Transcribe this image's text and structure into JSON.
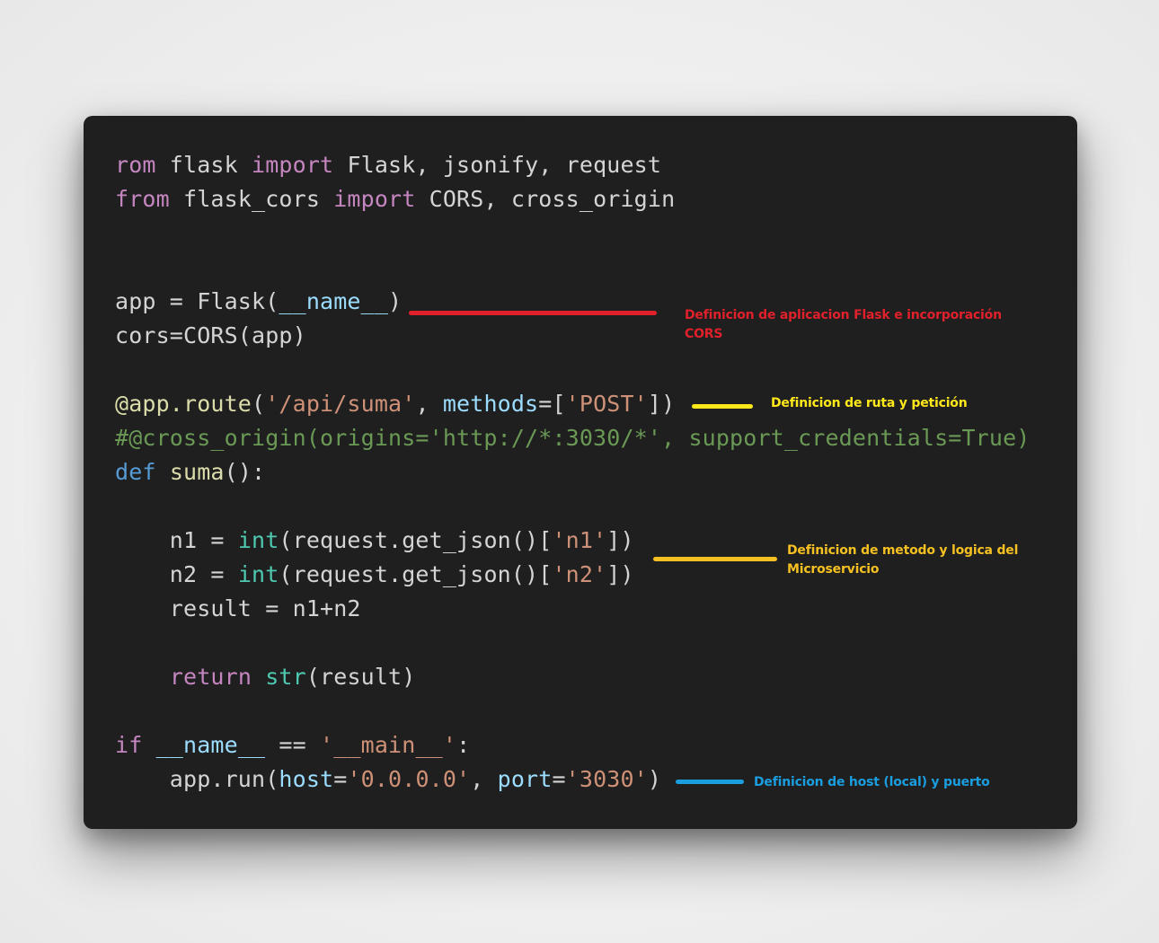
{
  "code": {
    "line1": {
      "t1": "rom",
      "t2": " flask ",
      "t3": "import",
      "t4": " Flask, jsonify, request"
    },
    "line2": {
      "t1": "from",
      "t2": " flask_cors ",
      "t3": "import",
      "t4": " CORS, cross_origin"
    },
    "line3": {
      "t1": "app = Flask(",
      "t2": "__name__",
      "t3": ")"
    },
    "line4": {
      "t1": "cors=CORS(app)"
    },
    "line5": {
      "t1": "@app.route",
      "t2": "(",
      "t3": "'/api/suma'",
      "t4": ", ",
      "t5": "methods",
      "t6": "=[",
      "t7": "'POST'",
      "t8": "])"
    },
    "line6": {
      "t1": "#@cross_origin(origins='http://*:3030/*', support_credentials=True)"
    },
    "line7": {
      "t1": "def",
      "t2": " ",
      "t3": "suma",
      "t4": "():"
    },
    "line8": {
      "t1": "    n1 = ",
      "t2": "int",
      "t3": "(request.get_json()[",
      "t4": "'n1'",
      "t5": "])"
    },
    "line9": {
      "t1": "    n2 = ",
      "t2": "int",
      "t3": "(request.get_json()[",
      "t4": "'n2'",
      "t5": "])"
    },
    "line10": {
      "t1": "    result = n1+n2"
    },
    "line11": {
      "t1": "    ",
      "t2": "return",
      "t3": " ",
      "t4": "str",
      "t5": "(result)"
    },
    "line12": {
      "t1": "if",
      "t2": " ",
      "t3": "__name__",
      "t4": " == ",
      "t5": "'__main__'",
      "t6": ":"
    },
    "line13": {
      "t1": "    app.run(",
      "t2": "host",
      "t3": "=",
      "t4": "'0.0.0.0'",
      "t5": ", ",
      "t6": "port",
      "t7": "=",
      "t8": "'3030'",
      "t9": ")"
    }
  },
  "annotations": {
    "flask_cors": {
      "line1": "Definicion de aplicacion Flask e incorporación",
      "line2": "CORS",
      "color": "#e0202a"
    },
    "route": {
      "line1": "Definicion de ruta y petición",
      "color": "#ffe81a"
    },
    "logic": {
      "line1": "Definicion de metodo y logica del",
      "line2": "Microservicio",
      "color": "#f5c021"
    },
    "host": {
      "line1": "Definicion de host (local) y puerto",
      "color": "#1a9ee0"
    }
  },
  "colors": {
    "background": "#f2f2f2",
    "card": "#1f1f1f",
    "keyword_purple": "#c586c0",
    "keyword_blue": "#569cd6",
    "function": "#dcdcaa",
    "builtin": "#4ec9b0",
    "string": "#ce9178",
    "parameter": "#9cdcfe",
    "comment": "#6a9955",
    "text": "#d4d4d4"
  }
}
